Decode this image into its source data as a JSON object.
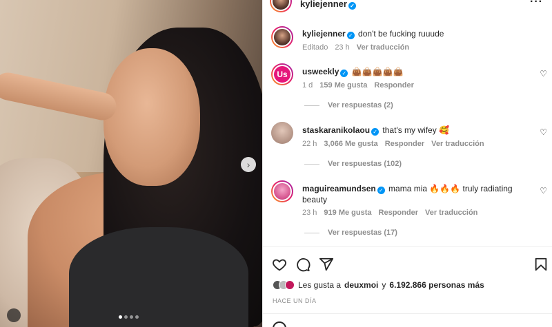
{
  "post": {
    "author": "kyliejenner",
    "caption": "don't be fucking ruuude",
    "edited_label": "Editado",
    "time": "23 h",
    "translate_label": "Ver traducción"
  },
  "comments": [
    {
      "user": "usweekly",
      "text": "👜👜👜👜👜",
      "time": "1 d",
      "likes": "159 Me gusta",
      "reply_label": "Responder",
      "replies_label": "Ver respuestas (2)"
    },
    {
      "user": "staskaranikolaou",
      "text": "that's my wifey 🥰",
      "time": "22 h",
      "likes": "3,066 Me gusta",
      "reply_label": "Responder",
      "translate_label": "Ver traducción",
      "replies_label": "Ver respuestas (102)"
    },
    {
      "user": "maguireamundsen",
      "text": "mama mia 🔥🔥🔥 truly radiating beauty",
      "time": "23 h",
      "likes": "919 Me gusta",
      "reply_label": "Responder",
      "translate_label": "Ver traducción",
      "replies_label": "Ver respuestas (17)"
    }
  ],
  "likes_summary": {
    "prefix": "Les gusta a",
    "first_user": "deuxmoi",
    "connector": "y",
    "others": "6.192.866 personas más"
  },
  "posted_ago": "HACE UN DÍA",
  "carousel": {
    "current": 1,
    "total": 4
  },
  "icons": [
    "heart-icon",
    "comment-icon",
    "share-icon",
    "bookmark-icon",
    "more-icon",
    "next-arrow-icon"
  ],
  "colors": {
    "verified": "#0095f6",
    "muted": "#8e8e8e",
    "text": "#262626"
  }
}
